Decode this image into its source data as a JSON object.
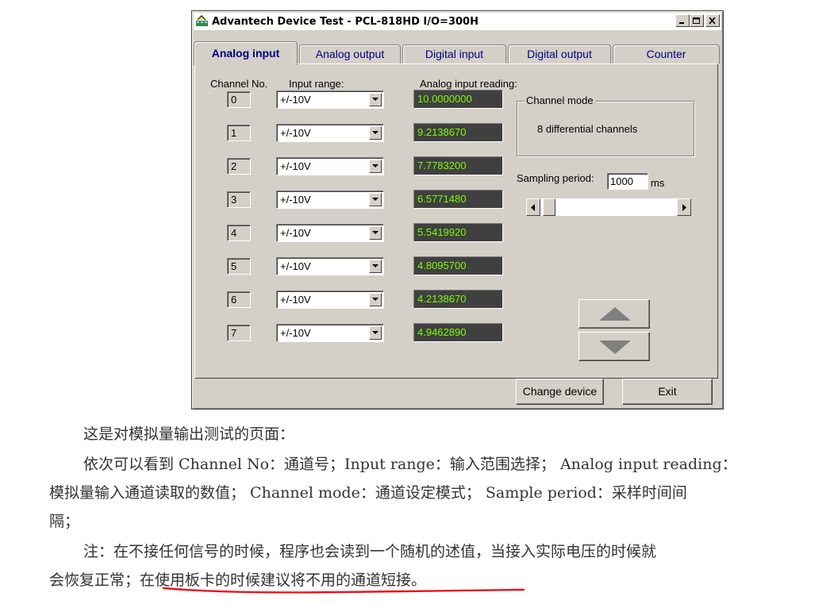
{
  "window": {
    "title": "Advantech Device Test - PCL-818HD I/O=300H"
  },
  "tabs": [
    {
      "label": "Analog input",
      "active": true
    },
    {
      "label": "Analog output",
      "active": false
    },
    {
      "label": "Digital input",
      "active": false
    },
    {
      "label": "Digital output",
      "active": false
    },
    {
      "label": "Counter",
      "active": false
    }
  ],
  "panel": {
    "channel_no_header": "Channel No.",
    "input_range_header": "Input range:",
    "reading_header": "Analog input reading:",
    "channels": [
      {
        "no": "0",
        "range": "+/-10V",
        "reading": "10.0000000"
      },
      {
        "no": "1",
        "range": "+/-10V",
        "reading": "9.2138670"
      },
      {
        "no": "2",
        "range": "+/-10V",
        "reading": "7.7783200"
      },
      {
        "no": "3",
        "range": "+/-10V",
        "reading": "6.5771480"
      },
      {
        "no": "4",
        "range": "+/-10V",
        "reading": "5.5419920"
      },
      {
        "no": "5",
        "range": "+/-10V",
        "reading": "4.8095700"
      },
      {
        "no": "6",
        "range": "+/-10V",
        "reading": "4.2138670"
      },
      {
        "no": "7",
        "range": "+/-10V",
        "reading": "4.9462890"
      }
    ],
    "channel_mode": {
      "title": "Channel mode",
      "value": "8  differential channels"
    },
    "sampling": {
      "label": "Sampling period:",
      "value": "1000",
      "unit": "ms",
      "slider_fraction": 0.02
    }
  },
  "footer": {
    "change_device": "Change device",
    "exit": "Exit"
  },
  "doc": {
    "line1": "这是对模拟量输出测试的页面：",
    "line2": "依次可以看到 Channel No：通道号；Input range：输入范围选择；  Analog input reading：",
    "line3": "模拟量输入通道读取的数值；  Channel mode：通道设定模式；  Sample period：采样时间间",
    "line4": "隔；",
    "line5": "注：在不接任何信号的时候，程序也会读到一个随机的述值，当接入实际电压的时候就",
    "line6a": "会恢复正常；",
    "line6b": "在使用板卡的时候建议将不用的通道短接。"
  },
  "colors": {
    "face": "#d4d0c8",
    "reading_bg": "#404040",
    "reading_text": "#7cfc00",
    "tab_text": "#000080",
    "annotation_underline": "#e8141c"
  }
}
